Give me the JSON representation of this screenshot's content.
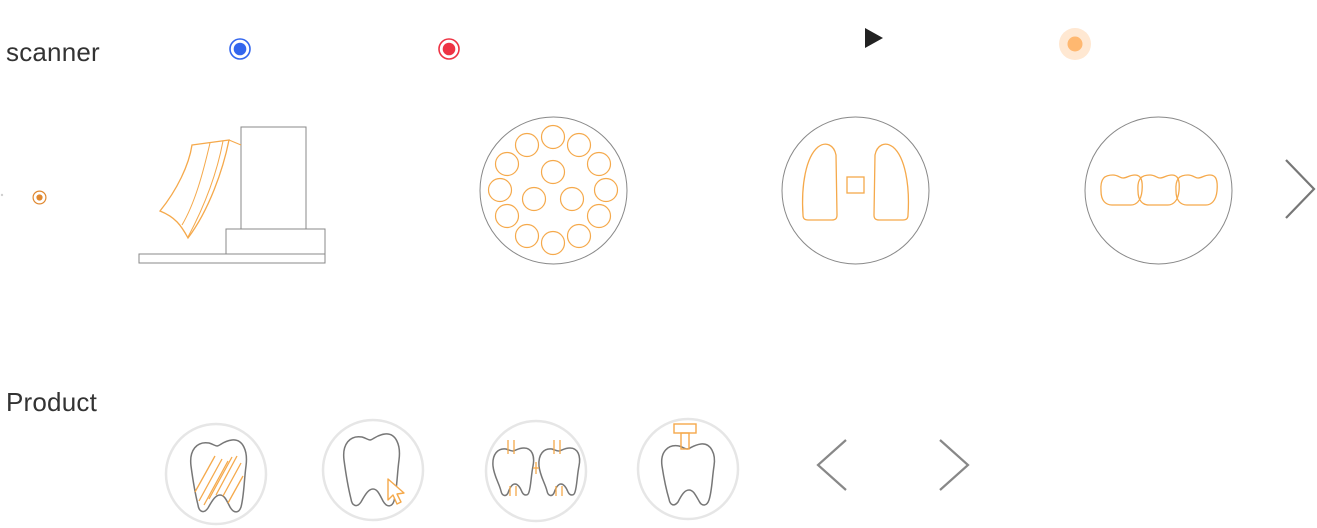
{
  "sections": {
    "scanner_label": "scanner",
    "product_label": "Product"
  },
  "colors": {
    "accent_orange": "#F5A94B",
    "radio_blue": "#3366EE",
    "radio_red": "#EE3344",
    "radio_orange_light": "#FFB870",
    "outline_gray": "#888888",
    "text": "#333333"
  },
  "scanner": {
    "top_indicators": [
      {
        "name": "blue-radio",
        "color": "blue",
        "selected": true
      },
      {
        "name": "red-radio",
        "color": "red",
        "selected": true
      },
      {
        "name": "play-icon"
      },
      {
        "name": "orange-radio",
        "color": "orange",
        "selected": true
      }
    ],
    "side_radio": {
      "color": "orange",
      "selected": true
    },
    "cards": [
      {
        "icon": "scanner-device-icon"
      },
      {
        "icon": "multi-die-tray-icon"
      },
      {
        "icon": "two-dies-icon"
      },
      {
        "icon": "bridge-teeth-icon"
      }
    ],
    "next_icon": "chevron-right-icon"
  },
  "product": {
    "items": [
      {
        "icon": "tooth-shaded-icon"
      },
      {
        "icon": "tooth-cursor-icon"
      },
      {
        "icon": "tooth-pair-pins-icon"
      },
      {
        "icon": "tooth-implant-icon"
      }
    ],
    "prev_icon": "chevron-left-icon",
    "next_icon": "chevron-right-icon"
  }
}
